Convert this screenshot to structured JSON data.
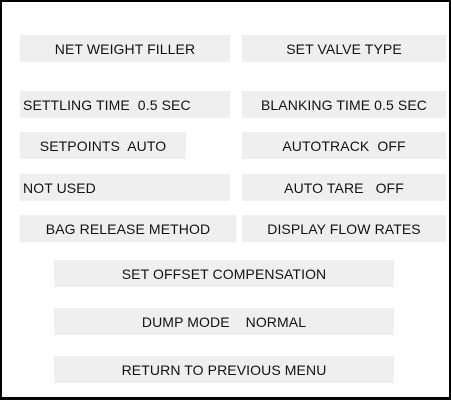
{
  "menu": {
    "net_weight_filler": "NET WEIGHT FILLER",
    "set_valve_type": "SET VALVE TYPE",
    "settling_time": "SETTLING TIME  0.5 SEC",
    "blanking_time": "BLANKING TIME 0.5 SEC",
    "setpoints": "SETPOINTS  AUTO",
    "autotrack": "AUTOTRACK  OFF",
    "not_used": "NOT USED",
    "auto_tare": "AUTO TARE   OFF",
    "bag_release_method": "BAG RELEASE METHOD",
    "display_flow_rates": "DISPLAY FLOW RATES",
    "set_offset_compensation": "SET OFFSET COMPENSATION",
    "dump_mode": "DUMP MODE    NORMAL",
    "return_to_previous_menu": "RETURN TO PREVIOUS MENU"
  },
  "colors": {
    "button_bg": "#efefef",
    "border": "#000000",
    "text": "#111111"
  }
}
